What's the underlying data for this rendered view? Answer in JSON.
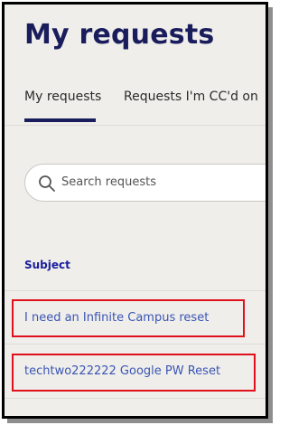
{
  "page": {
    "title": "My requests"
  },
  "tabs": [
    {
      "label": "My requests",
      "active": true
    },
    {
      "label": "Requests I'm CC'd on",
      "active": false
    }
  ],
  "search": {
    "placeholder": "Search requests",
    "icon": "search-icon"
  },
  "table": {
    "columns": [
      "Subject"
    ],
    "rows": [
      {
        "subject": "I need an Infinite Campus reset",
        "highlighted": true
      },
      {
        "subject": "techtwo222222 Google PW Reset",
        "highlighted": true
      }
    ]
  },
  "colors": {
    "heading": "#1a1d5c",
    "link": "#3a55b4",
    "highlight_box": "#e0101c",
    "page_background": "#efeeea"
  }
}
